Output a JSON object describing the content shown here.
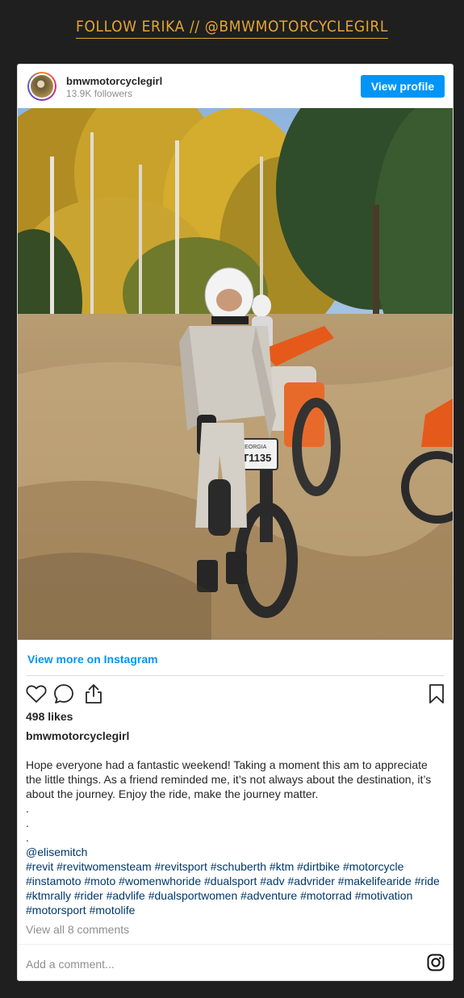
{
  "banner": {
    "text": "FOLLOW ERIKA // @BMWMOTORCYCLEGIRL"
  },
  "post": {
    "username": "bmwmotorcyclegirl",
    "followers": "13.9K followers",
    "view_profile_label": "View profile",
    "view_more_label": "View more on Instagram",
    "likes": "498 likes",
    "caption_username": "bmwmotorcyclegirl",
    "caption_text": "Hope everyone had a fantastic weekend! Taking a moment this am to appreciate the little things. As a friend reminded me, it’s not always about the destination, it’s about the journey. Enjoy the ride, make the journey matter.\n.\n.\n.",
    "mention": "@elisemitch",
    "hashtags": "#revit #revitwomensteam #revitsport #schuberth #ktm #dirtbike #motorcycle #instamoto #moto #womenwhoride #dualsport #adv #advrider #makelifearide #ride #ktmrally #rider #advlife #dualsportwomen #adventure #motorrad #motivation #motorsport #motolife",
    "view_comments": "View all 8 comments",
    "add_comment_placeholder": "Add a comment...",
    "photo_plate_text": "ET1135",
    "photo_plate_state": "GEORGIA"
  },
  "colors": {
    "banner": "#e4a532",
    "primary_button": "#0095f6",
    "page_background": "#1f1f1f"
  },
  "icons": [
    "heart-icon",
    "comment-icon",
    "share-icon",
    "bookmark-icon",
    "instagram-icon"
  ]
}
